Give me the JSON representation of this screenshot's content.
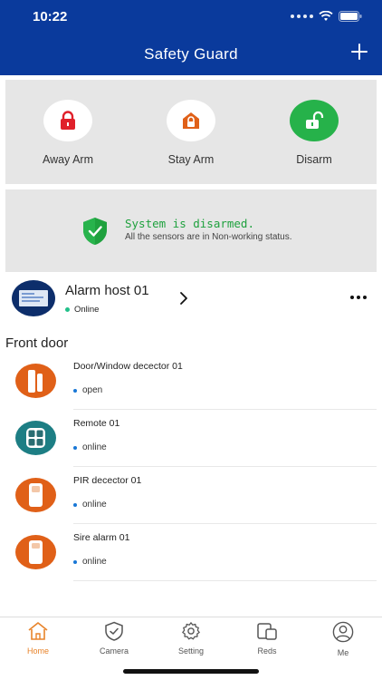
{
  "status_bar": {
    "time": "10:22"
  },
  "header": {
    "title": "Safety Guard"
  },
  "arm_modes": [
    {
      "label": "Away Arm",
      "icon": "lock-icon",
      "color": "#e0202a"
    },
    {
      "label": "Stay Arm",
      "icon": "home-lock-icon",
      "color": "#e06018"
    },
    {
      "label": "Disarm",
      "icon": "unlock-icon",
      "color": "#26b24a"
    }
  ],
  "system_status": {
    "title": "System is disarmed.",
    "subtitle": "All the sensors are in Non-working status."
  },
  "host": {
    "name": "Alarm host 01",
    "status": "Online"
  },
  "section": {
    "title": "Front door"
  },
  "devices": [
    {
      "name": "Door/Window decector 01",
      "status": "open",
      "icon": "door-sensor-icon"
    },
    {
      "name": "Remote 01",
      "status": "online",
      "icon": "remote-icon"
    },
    {
      "name": "PIR decector 01",
      "status": "online",
      "icon": "pir-sensor-icon"
    },
    {
      "name": "Sire alarm 01",
      "status": "online",
      "icon": "siren-icon"
    }
  ],
  "tabs": [
    {
      "label": "Home",
      "icon": "home-icon",
      "active": true
    },
    {
      "label": "Camera",
      "icon": "shield-camera-icon"
    },
    {
      "label": "Setting",
      "icon": "gear-icon"
    },
    {
      "label": "Reds",
      "icon": "devices-icon"
    },
    {
      "label": "Me",
      "icon": "user-icon"
    }
  ],
  "colors": {
    "header": "#0a3a9c",
    "accent": "#e8832a",
    "ok": "#1fa13e"
  }
}
